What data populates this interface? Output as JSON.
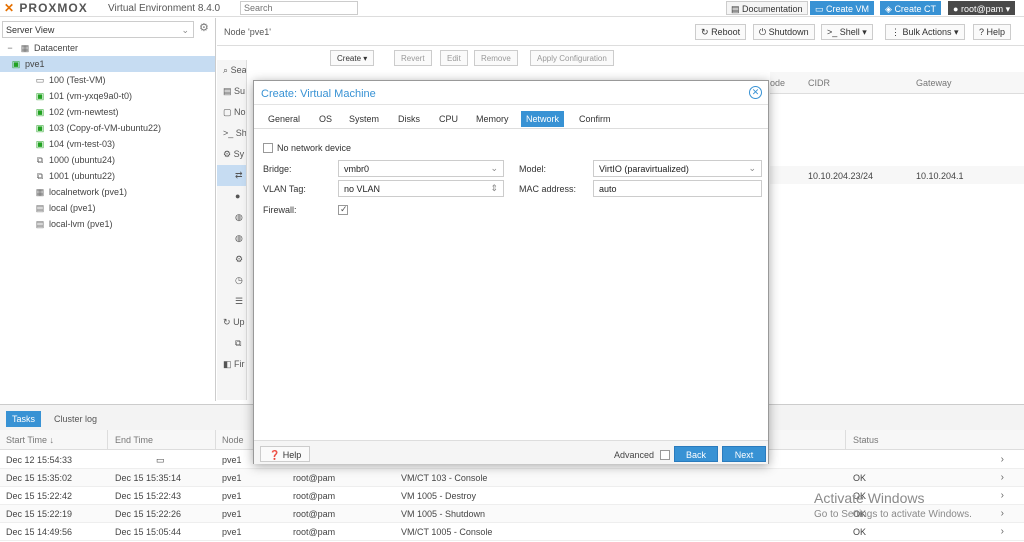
{
  "topbar": {
    "logo": "PROXMOX",
    "version": "Virtual Environment 8.4.0",
    "search_placeholder": "Search",
    "documentation": "Documentation",
    "create_vm": "Create VM",
    "create_ct": "Create CT",
    "user": "root@pam"
  },
  "sidebar": {
    "view": "Server View",
    "items": [
      {
        "label": "Datacenter"
      },
      {
        "label": "pve1"
      },
      {
        "label": "100 (Test-VM)"
      },
      {
        "label": "101 (vm-yxqe9a0-t0)"
      },
      {
        "label": "102 (vm-newtest)"
      },
      {
        "label": "103 (Copy-of-VM-ubuntu22)"
      },
      {
        "label": "104 (vm-test-03)"
      },
      {
        "label": "1000 (ubuntu24)"
      },
      {
        "label": "1001 (ubuntu22)"
      },
      {
        "label": "localnetwork (pve1)"
      },
      {
        "label": "local (pve1)"
      },
      {
        "label": "local-lvm (pve1)"
      }
    ]
  },
  "header": {
    "node_title": "Node 'pve1'",
    "reboot": "Reboot",
    "shutdown": "Shutdown",
    "shell": "Shell",
    "bulk_actions": "Bulk Actions",
    "help": "Help"
  },
  "subtoolbar": {
    "create": "Create",
    "revert": "Revert",
    "edit": "Edit",
    "remove": "Remove",
    "apply": "Apply Configuration"
  },
  "midmenu": {
    "items": [
      "Search",
      "Su",
      "No",
      "Sh",
      "Sy",
      "",
      "",
      "",
      "",
      "",
      "",
      "",
      "Up",
      "",
      "Fir"
    ]
  },
  "bg_grid": {
    "cols": [
      "ode",
      "CIDR",
      "Gateway"
    ],
    "row": {
      "cidr": "10.10.204.23/24",
      "gateway": "10.10.204.1"
    }
  },
  "tasks": {
    "tabs": [
      "Tasks",
      "Cluster log"
    ],
    "headers": [
      "Start Time",
      "End Time",
      "Node",
      "Status"
    ],
    "rows": [
      {
        "start": "Dec 12 15:54:33",
        "end": "",
        "node": "pve1",
        "user": "",
        "desc": "",
        "status": ""
      },
      {
        "start": "Dec 15 15:35:02",
        "end": "Dec 15 15:35:14",
        "node": "pve1",
        "user": "root@pam",
        "desc": "VM/CT 103 - Console",
        "status": "OK"
      },
      {
        "start": "Dec 15 15:22:42",
        "end": "Dec 15 15:22:43",
        "node": "pve1",
        "user": "root@pam",
        "desc": "VM 1005 - Destroy",
        "status": "OK"
      },
      {
        "start": "Dec 15 15:22:19",
        "end": "Dec 15 15:22:26",
        "node": "pve1",
        "user": "root@pam",
        "desc": "VM 1005 - Shutdown",
        "status": "OK"
      },
      {
        "start": "Dec 15 14:49:56",
        "end": "Dec 15 15:05:44",
        "node": "pve1",
        "user": "root@pam",
        "desc": "VM/CT 1005 - Console",
        "status": "OK"
      }
    ]
  },
  "watermark": {
    "line1": "Activate Windows",
    "line2": "Go to Settings to activate Windows."
  },
  "modal": {
    "title": "Create: Virtual Machine",
    "tabs": [
      "General",
      "OS",
      "System",
      "Disks",
      "CPU",
      "Memory",
      "Network",
      "Confirm"
    ],
    "active_tab": "Network",
    "no_network_label": "No network device",
    "bridge_label": "Bridge:",
    "bridge_value": "vmbr0",
    "vlan_label": "VLAN Tag:",
    "vlan_value": "no VLAN",
    "firewall_label": "Firewall:",
    "firewall_checked": true,
    "model_label": "Model:",
    "model_value": "VirtIO (paravirtualized)",
    "mac_label": "MAC address:",
    "mac_value": "auto",
    "help": "Help",
    "advanced": "Advanced",
    "back": "Back",
    "next": "Next"
  },
  "colors": {
    "accent": "#3892d4",
    "brand_orange": "#e57000"
  }
}
